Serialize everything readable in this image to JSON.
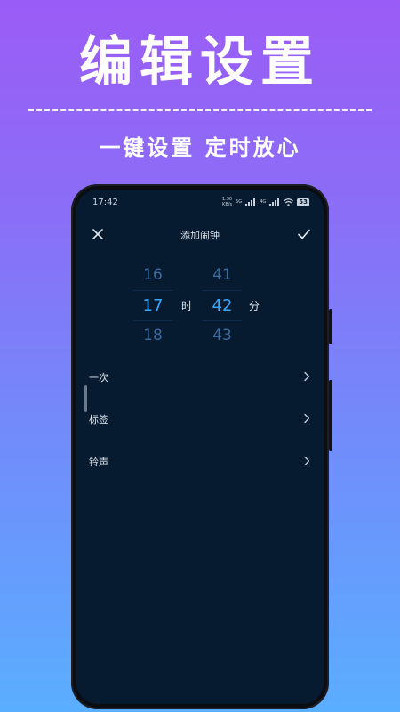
{
  "promo": {
    "headline": "编辑设置",
    "subtitle": "一键设置 定时放心"
  },
  "status_bar": {
    "time": "17:42",
    "net_speed_value": "1.30",
    "net_speed_unit": "KB/s",
    "label_5g": "5G",
    "label_4g": "4G",
    "battery": "53"
  },
  "header": {
    "title": "添加闹钟",
    "close_icon": "close-icon",
    "confirm_icon": "check-icon"
  },
  "time_picker": {
    "hour_prev": "16",
    "hour_selected": "17",
    "hour_next": "18",
    "hour_unit": "时",
    "minute_prev": "41",
    "minute_selected": "42",
    "minute_next": "43",
    "minute_unit": "分"
  },
  "settings": {
    "items": [
      {
        "label": "一次"
      },
      {
        "label": "标签"
      },
      {
        "label": "铃声"
      }
    ]
  },
  "colors": {
    "background_top": "#9b5cf6",
    "background_bottom": "#5aaeff",
    "screen_bg": "#061a30",
    "accent": "#3aa7ff"
  }
}
